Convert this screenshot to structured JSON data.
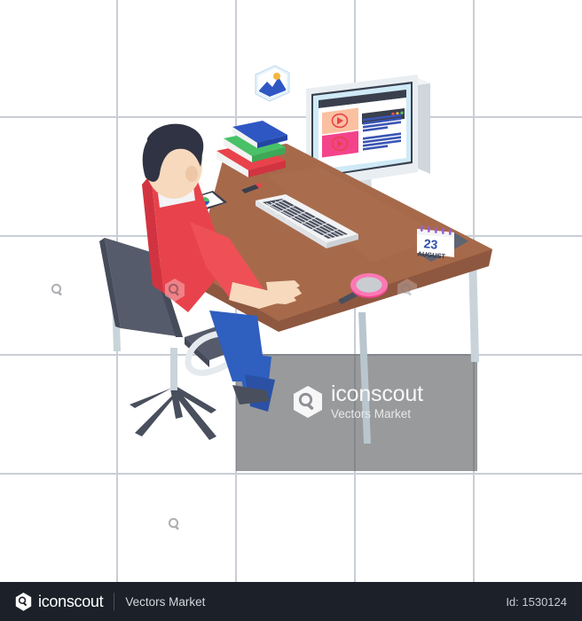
{
  "artboard": {
    "background_color": "#ffffff",
    "grid_color": "#c9ced6",
    "floor_shadow_color": "#5a5c60"
  },
  "watermark": {
    "brand": "iconscout",
    "tagline": "Vectors Market",
    "mark_icon": "iconscout-hexagon-search-icon",
    "badge_icon": "iconscout-hexagon-badge-icon",
    "badge_count": 4
  },
  "footer": {
    "brand": "iconscout",
    "brand_icon": "iconscout-hexagon-search-icon",
    "vendor": "Vectors Market",
    "asset_id_label": "Id: 1530124",
    "background_color": "#1b2029"
  },
  "illustration": {
    "title": "Man watching video tutorials at isometric workstation",
    "palette": {
      "desk_top": "#a66a4b",
      "desk_top_light": "#b5764f",
      "desk_edge": "#8e5740",
      "desk_leg": "#b9c6cd",
      "shirt": "#e8434c",
      "shirt_shade": "#d13440",
      "skin": "#f7d9bd",
      "skin_shade": "#edc7a6",
      "hair": "#2f3343",
      "jeans": "#2f5fbf",
      "jeans_shade": "#2a51a4",
      "chair": "#565b6b",
      "chair_dark": "#3f4453",
      "monitor_body": "#e9eef2",
      "monitor_frame": "#3a3f4d",
      "screen_bg": "#cfeaf7",
      "accent_pink": "#f4438b",
      "accent_peach": "#fbc0a0",
      "accent_red": "#e8434c",
      "book_blue": "#2f57c4",
      "book_green": "#49c168",
      "book_red": "#e8434c"
    },
    "objects": [
      {
        "name": "monitor",
        "label": "Desktop monitor",
        "screen_content": {
          "window_titlebar_dots": [
            "#ef5350",
            "#f5b63d",
            "#53c45c"
          ],
          "video_cards": [
            {
              "thumbnail_color": "#fbc0a0",
              "play_icon": "play-button-icon",
              "play_color": "#e8434c"
            },
            {
              "thumbnail_color": "#f4438b",
              "play_icon": "play-button-icon",
              "play_color": "#e8434c"
            }
          ],
          "text_line_color": "#3a55b5",
          "text_line_groups": [
            4,
            4
          ]
        }
      },
      {
        "name": "keyboard",
        "label": "Wireless keyboard",
        "body_color": "#f2f3f5",
        "key_color": "#4a4f5e"
      },
      {
        "name": "books-stack",
        "label": "Stack of books",
        "books": [
          {
            "color": "#e8434c",
            "label": "red book"
          },
          {
            "color": "#49c168",
            "label": "green book"
          },
          {
            "color": "#2f57c4",
            "label": "blue book"
          }
        ]
      },
      {
        "name": "desk-calendar",
        "label": "Desk calendar",
        "day": "23",
        "month": "AUGUST",
        "day_color": "#2f4fa8",
        "binding_color": "#9b5fd6"
      },
      {
        "name": "magnifier",
        "label": "Magnifying glass",
        "ring_color": "#f4438b",
        "handle_color": "#4a4f5e"
      },
      {
        "name": "smartphone",
        "label": "Smartphone showing color wheel",
        "body_color": "#3a3f4d",
        "screen_color": "#ffffff"
      },
      {
        "name": "pencil",
        "label": "Pencil",
        "body_color": "#3a3f4d",
        "tip_color": "#e8434c"
      },
      {
        "name": "photo-icon",
        "label": "Floating image thumbnail",
        "sky_color": "#dff0fb",
        "sun_color": "#f5b63d",
        "mountain_color": "#2f57c4"
      },
      {
        "name": "office-chair",
        "label": "Office chair with 5-star base",
        "color": "#565b6b"
      },
      {
        "name": "person",
        "label": "Man seated, viewed from behind",
        "shirt_color": "#e8434c",
        "pants_color": "#2f5fbf",
        "hair_color": "#2f3343"
      }
    ]
  }
}
